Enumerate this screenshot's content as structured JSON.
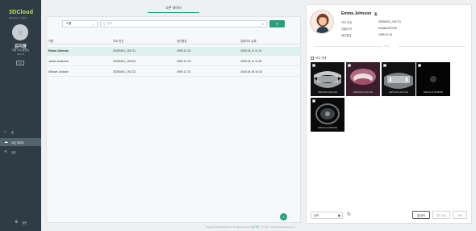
{
  "sidebar": {
    "logo": "3DCloud",
    "logo_sub": "덴탈 클라우드 플랫폼",
    "avatar_initial": "김",
    "user_name": "김지윤",
    "clinic": "덕유 치과 원장님",
    "role": "Dentist",
    "user_button": "정보",
    "nav": [
      {
        "label": "홈",
        "icon": "home-icon"
      },
      {
        "label": "오픈 데이터",
        "icon": "cloud-icon"
      },
      {
        "label": "공유",
        "icon": "share-icon"
      }
    ],
    "settings_label": "설정"
  },
  "main": {
    "tab_label": "오픈 데이터",
    "search_type": "이름",
    "search_placeholder": "검색",
    "columns": [
      "이름",
      "차트 번호",
      "생년월일",
      "업데이트 날짜"
    ],
    "rows": [
      {
        "name": "Emma Johnson",
        "chart": "20250401_151711",
        "birth": "1999-12-31",
        "updated": "2025-04-11 11:14"
      },
      {
        "name": "James Anderson",
        "chart": "20250401_151513",
        "birth": "1999-12-31",
        "updated": "2025-04-11 11:08"
      },
      {
        "name": "Michael Jackson",
        "chart": "20250401_151722",
        "birth": "1999-12-31",
        "updated": "2025-04-08 10:33"
      }
    ],
    "current_page": "1",
    "footer_text": "Copyright ©3dentalCloud co. All rights reserved.",
    "footer_link": "이용 약관",
    "footer_contact": "고객 지원: contact@3dentalCloud.com"
  },
  "patient": {
    "name": "Emma Johnson",
    "fields": [
      {
        "label": "차트 번호",
        "value": "20250401_151711"
      },
      {
        "label": "성별/나이",
        "value": "female/25YOM"
      },
      {
        "label": "생년월일",
        "value": "1999-12-31"
      }
    ],
    "divider_label": "이미지",
    "select_all_label": "모두 선택",
    "images": [
      {
        "date": "2025-04-04 (10:13:44)",
        "kind": "panoramic"
      },
      {
        "date": "2025-04-04 (10:13:44)",
        "kind": "intraoral"
      },
      {
        "date": "2025-04-04 (10:13:44)",
        "kind": "panoramic"
      },
      {
        "date": "2025-04-12 (15:58:09)",
        "kind": "cephalo"
      },
      {
        "date": "2025-04-12 (15:58:09)",
        "kind": "ct"
      }
    ],
    "date_value": "검색",
    "buttons": {
      "view": "열 뷰어",
      "print": "결과 생성",
      "delete": "삭제"
    }
  },
  "colors": {
    "accent": "#29a07a",
    "sidebar": "#2f3b45",
    "selected_row": "#dff1ec"
  }
}
